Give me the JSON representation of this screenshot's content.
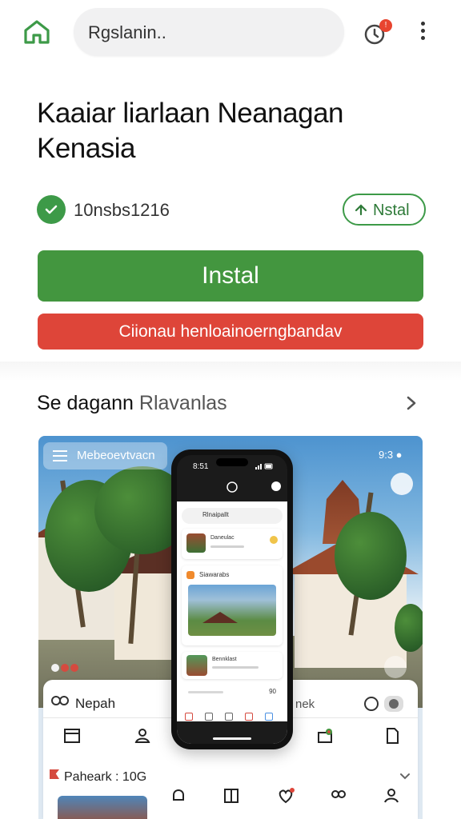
{
  "header": {
    "search_text": "Rgslanin.."
  },
  "title": {
    "line1": "Kaaiar liarlaan Neanagan",
    "line2": "Kenasia"
  },
  "meta": {
    "version_text": "10nsbs1216",
    "small_install_label": "Nstal"
  },
  "actions": {
    "primary_label": "Instal",
    "secondary_label": "Ciionau henloainoerngbandav"
  },
  "section": {
    "title_bold": "Se  dagann",
    "title_light": "Rlavanlas"
  },
  "preview": {
    "top_pill_label": "Mebeoevtvacn",
    "right_status": "9:3 ●",
    "brand_label": "Nepah",
    "right_label": "nek",
    "row_label": "Paheark : 10G"
  },
  "phone": {
    "time": "8:51",
    "search_label": "Rlnaipallt",
    "card1_title": "Daneulac",
    "card2_header": "Siawarabs",
    "card3_title": "Bennklast",
    "small_num": "90"
  }
}
